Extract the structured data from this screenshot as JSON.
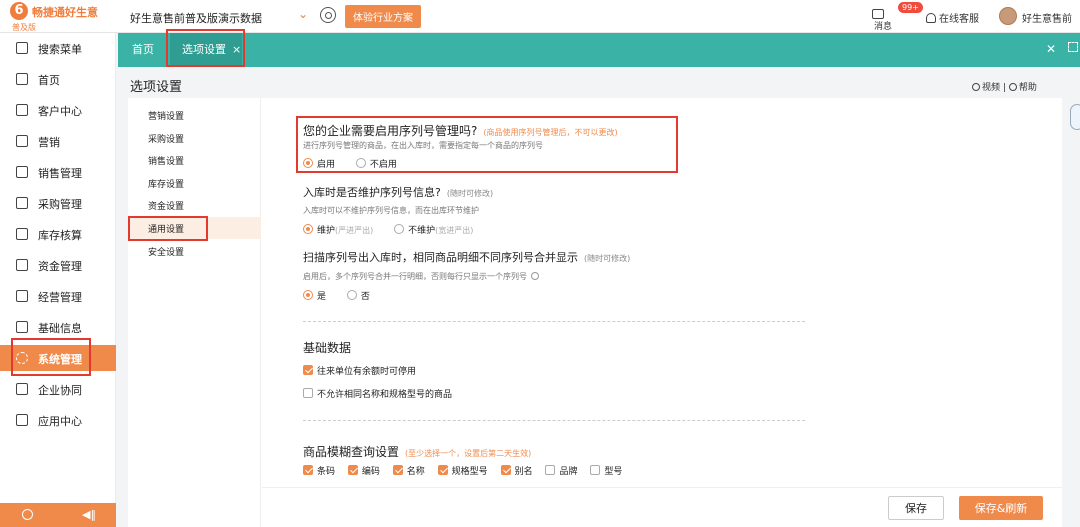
{
  "topbar": {
    "logo_mark": "6",
    "logo_name": "畅捷通好生意",
    "logo_edition": "普及版",
    "company_name": "好生意售前普及版演示数据",
    "trial_button": "体验行业方案",
    "messages_label": "消息",
    "messages_badge": "99+",
    "service_label": "在线客服",
    "user_name": "好生意售前"
  },
  "sidebar": {
    "items": [
      {
        "label": "搜索菜单"
      },
      {
        "label": "首页"
      },
      {
        "label": "客户中心"
      },
      {
        "label": "营销"
      },
      {
        "label": "销售管理"
      },
      {
        "label": "采购管理"
      },
      {
        "label": "库存核算"
      },
      {
        "label": "资金管理"
      },
      {
        "label": "经营管理"
      },
      {
        "label": "基础信息"
      },
      {
        "label": "系统管理"
      },
      {
        "label": "企业协同"
      },
      {
        "label": "应用中心"
      }
    ],
    "active_index": 10
  },
  "tabs": {
    "home": "首页",
    "options": "选项设置",
    "close_glyph": "×"
  },
  "page": {
    "title": "选项设置",
    "video_link": "视频",
    "help_link": "帮助",
    "link_separator": "|"
  },
  "subnav": {
    "items": [
      {
        "label": "营销设置"
      },
      {
        "label": "采购设置"
      },
      {
        "label": "销售设置"
      },
      {
        "label": "库存设置"
      },
      {
        "label": "资金设置"
      },
      {
        "label": "通用设置"
      },
      {
        "label": "安全设置"
      }
    ],
    "active_index": 5
  },
  "settings": {
    "serial": {
      "title": "您的企业需要启用序列号管理吗?",
      "note": "(商品使用序列号管理后，不可以更改)",
      "desc": "进行序列号管理的商品，在出入库时，需要指定每一个商品的序列号",
      "options": [
        "启用",
        "不启用"
      ],
      "selected": 0
    },
    "inbound": {
      "title": "入库时是否维护序列号信息?",
      "note": "(随时可修改)",
      "desc": "入库时可以不维护序列号信息，而在出库环节维护",
      "options": [
        "维护",
        "不维护"
      ],
      "option_subs": [
        "(严进严出)",
        "(宽进严出)"
      ],
      "selected": 0
    },
    "merge": {
      "title": "扫描序列号出入库时，相同商品明细不同序列号合并显示",
      "note": "(随时可修改)",
      "desc": "启用后，多个序列号合并一行明细，否则每行只显示一个序列号",
      "options": [
        "是",
        "否"
      ],
      "selected": 0
    },
    "basic": {
      "title": "基础数据",
      "checks": [
        {
          "label": "往来单位有余额时可停用",
          "checked": true
        },
        {
          "label": "不允许相同名称和规格型号的商品",
          "checked": false
        }
      ]
    },
    "fuzzy": {
      "title": "商品模糊查询设置",
      "note": "(至少选择一个，设置后第二天生效)",
      "checks": [
        {
          "label": "条码",
          "checked": true
        },
        {
          "label": "编码",
          "checked": true
        },
        {
          "label": "名称",
          "checked": true
        },
        {
          "label": "规格型号",
          "checked": true
        },
        {
          "label": "别名",
          "checked": true
        },
        {
          "label": "品牌",
          "checked": false
        },
        {
          "label": "型号",
          "checked": false
        }
      ]
    }
  },
  "footer": {
    "save": "保存",
    "save_refresh": "保存&刷新"
  },
  "colors": {
    "accent": "#f08a4b",
    "tabs_bar": "#3ab3a6",
    "highlight": "#e23a2e"
  }
}
